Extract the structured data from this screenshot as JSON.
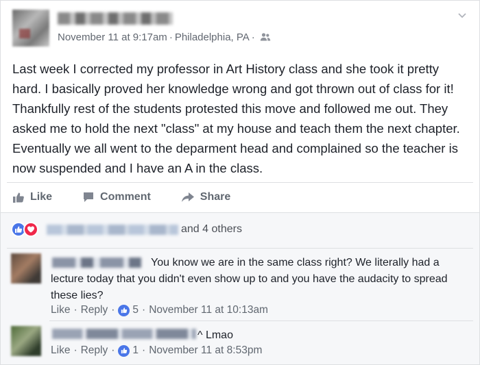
{
  "post": {
    "timestamp": "November 11 at 9:17am",
    "location": "Philadelphia, PA",
    "audience_icon": "friends-icon",
    "text": "Last week I corrected my professor in Art History class and she took it pretty hard. I basically proved her knowledge wrong and got thrown out of class for it! Thankfully rest of the students protested this move and followed me out. They asked me to hold the next \"class\" at my house and teach them the next chapter. Eventually we all went to the deparment head and complained so the teacher is now suspended and I have an A in the class."
  },
  "actions": {
    "like_label": "Like",
    "comment_label": "Comment",
    "share_label": "Share"
  },
  "reactions": {
    "others_text": "and 4 others"
  },
  "comments": [
    {
      "text": "You know we are in the same class right? We literally had a lecture today that you didn't even show up to and you have the audacity to spread these lies?",
      "like_label": "Like",
      "reply_label": "Reply",
      "likes": "5",
      "timestamp": "November 11 at 10:13am"
    },
    {
      "text": "^ Lmao",
      "like_label": "Like",
      "reply_label": "Reply",
      "likes": "1",
      "timestamp": "November 11 at 8:53pm"
    }
  ],
  "colors": {
    "like_blue": "#4a76e8",
    "love_red": "#f0284a",
    "muted_text": "#606770",
    "comment_bg": "#f6f7f9"
  }
}
